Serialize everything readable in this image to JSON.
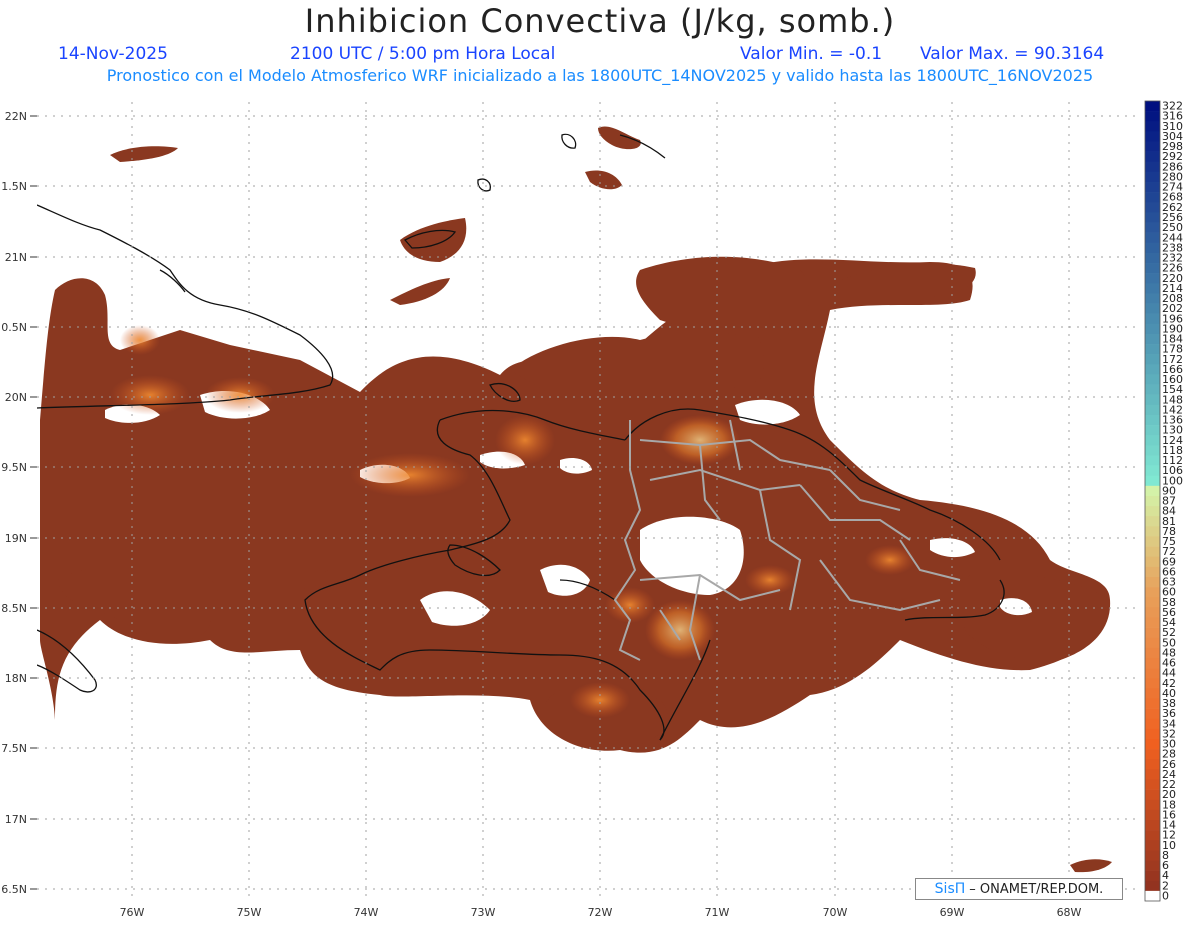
{
  "header": {
    "title": "Inhibicion Convectiva (J/kg, somb.)",
    "date": "14-Nov-2025",
    "time": "2100 UTC / 5:00 pm Hora Local",
    "valmin": "Valor Min. = -0.1",
    "valmax": "Valor Max. = 90.3164",
    "subtitle": "Pronostico con el Modelo Atmosferico WRF inicializado a las 1800UTC_14NOV2025 y valido hasta las  1800UTC_16NOV2025"
  },
  "map": {
    "lon_range": [
      -76.7,
      -67.5
    ],
    "lat_range": [
      16.4,
      22.1
    ],
    "field_color": "#8a3820",
    "lat_ticks": [
      "22N",
      "1.5N",
      "21N",
      "0.5N",
      "20N",
      "9.5N",
      "19N",
      "8.5N",
      "18N",
      "7.5N",
      "17N",
      "6.5N"
    ],
    "lon_ticks": [
      "76W",
      "75W",
      "74W",
      "73W",
      "72W",
      "71W",
      "70W",
      "69W",
      "68W"
    ]
  },
  "colorbar": {
    "labels": [
      "322",
      "316",
      "310",
      "304",
      "298",
      "292",
      "286",
      "280",
      "274",
      "268",
      "262",
      "256",
      "250",
      "244",
      "238",
      "232",
      "226",
      "220",
      "214",
      "208",
      "202",
      "196",
      "190",
      "184",
      "178",
      "172",
      "166",
      "160",
      "154",
      "148",
      "142",
      "136",
      "130",
      "124",
      "118",
      "112",
      "106",
      "100",
      "90",
      "87",
      "84",
      "81",
      "78",
      "75",
      "72",
      "69",
      "66",
      "63",
      "60",
      "58",
      "56",
      "54",
      "52",
      "50",
      "48",
      "46",
      "44",
      "42",
      "40",
      "38",
      "36",
      "34",
      "32",
      "30",
      "28",
      "26",
      "24",
      "22",
      "20",
      "18",
      "16",
      "14",
      "12",
      "10",
      "8",
      "6",
      "4",
      "2",
      "0"
    ]
  },
  "credit": {
    "sis": "SisΠ",
    "text": "– ONAMET/REP.DOM."
  }
}
